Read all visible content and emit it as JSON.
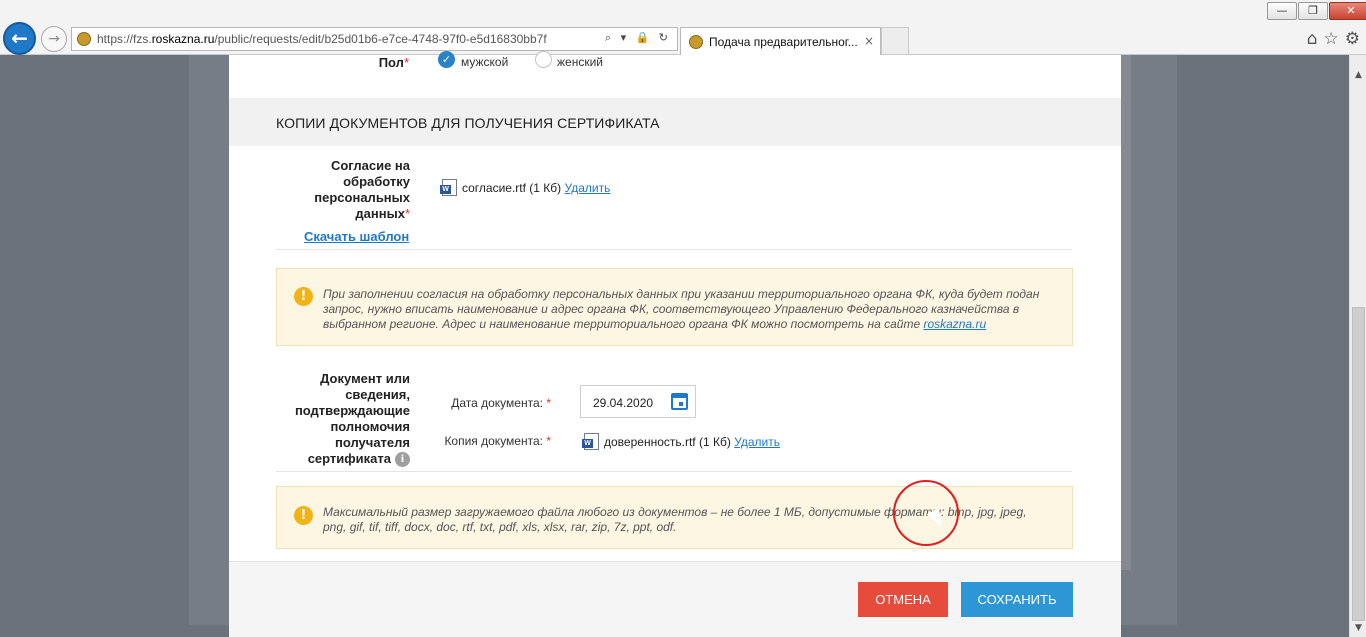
{
  "browser": {
    "url_prefix": "https://fzs.",
    "url_domain": "roskazna.ru",
    "url_path": "/public/requests/edit/b25d01b6-e7ce-4748-97f0-e5d16830bb7f",
    "address_tools": "⌕ ▾ 🔒 ↻",
    "tab_title": "Подача предварительног...",
    "tab_close": "×",
    "window_controls": [
      "—",
      "❐",
      "✕"
    ]
  },
  "form": {
    "gender": {
      "label": "Пол",
      "required_mark": "*",
      "options": [
        "мужской",
        "женский"
      ],
      "selected": "мужской"
    },
    "section_title": "КОПИИ ДОКУМЕНТОВ ДЛЯ ПОЛУЧЕНИЯ СЕРТИФИКАТА",
    "consent": {
      "label": "Согласие на обработку персональных данных",
      "required_mark": "*",
      "file_name": "согласие.rtf (1 Кб)",
      "delete_label": "Удалить",
      "template_link": "Скачать шаблон"
    },
    "notice_consent": {
      "text": "При заполнении согласия на обработку персональных данных при указании территориального органа ФК, куда будет подан запрос, нужно вписать наименование и адрес органа ФК, соответствующего Управлению Федерального казначейства в выбранном регионе. Адрес и наименование территориального органа ФК можно посмотреть на сайте ",
      "link": "roskazna.ru"
    },
    "authority_doc": {
      "label": "Документ или сведения, подтверждающие полномочия получателя сертификата",
      "date_label": "Дата документа:",
      "date_value": "29.04.2020",
      "copy_label": "Копия документа:",
      "required_mark": "*",
      "file_name": "доверенность.rtf (1 Кб)",
      "delete_label": "Удалить",
      "info_icon": "i"
    },
    "notice_limits": {
      "text": "Максимальный размер загружаемого файла любого из документов – не более 1 МБ, допустимые форматы: bmp, jpg, jpeg, png, gif, tif, tiff, docx, doc, rtf, txt, pdf, xls, xlsx, rar, zip, 7z, ppt, odf."
    }
  },
  "footer": {
    "cancel_label": "ОТМЕНА",
    "save_label": "СОХРАНИТЬ"
  },
  "icons": {
    "notice": "!",
    "radio_check": "✓",
    "back": "←",
    "forward": "→"
  },
  "colors": {
    "primary": "#2d97d6",
    "danger": "#e64b3c",
    "required": "#d9312b",
    "notice_bg": "#fdf6e3",
    "warning_icon": "#f2b316"
  }
}
